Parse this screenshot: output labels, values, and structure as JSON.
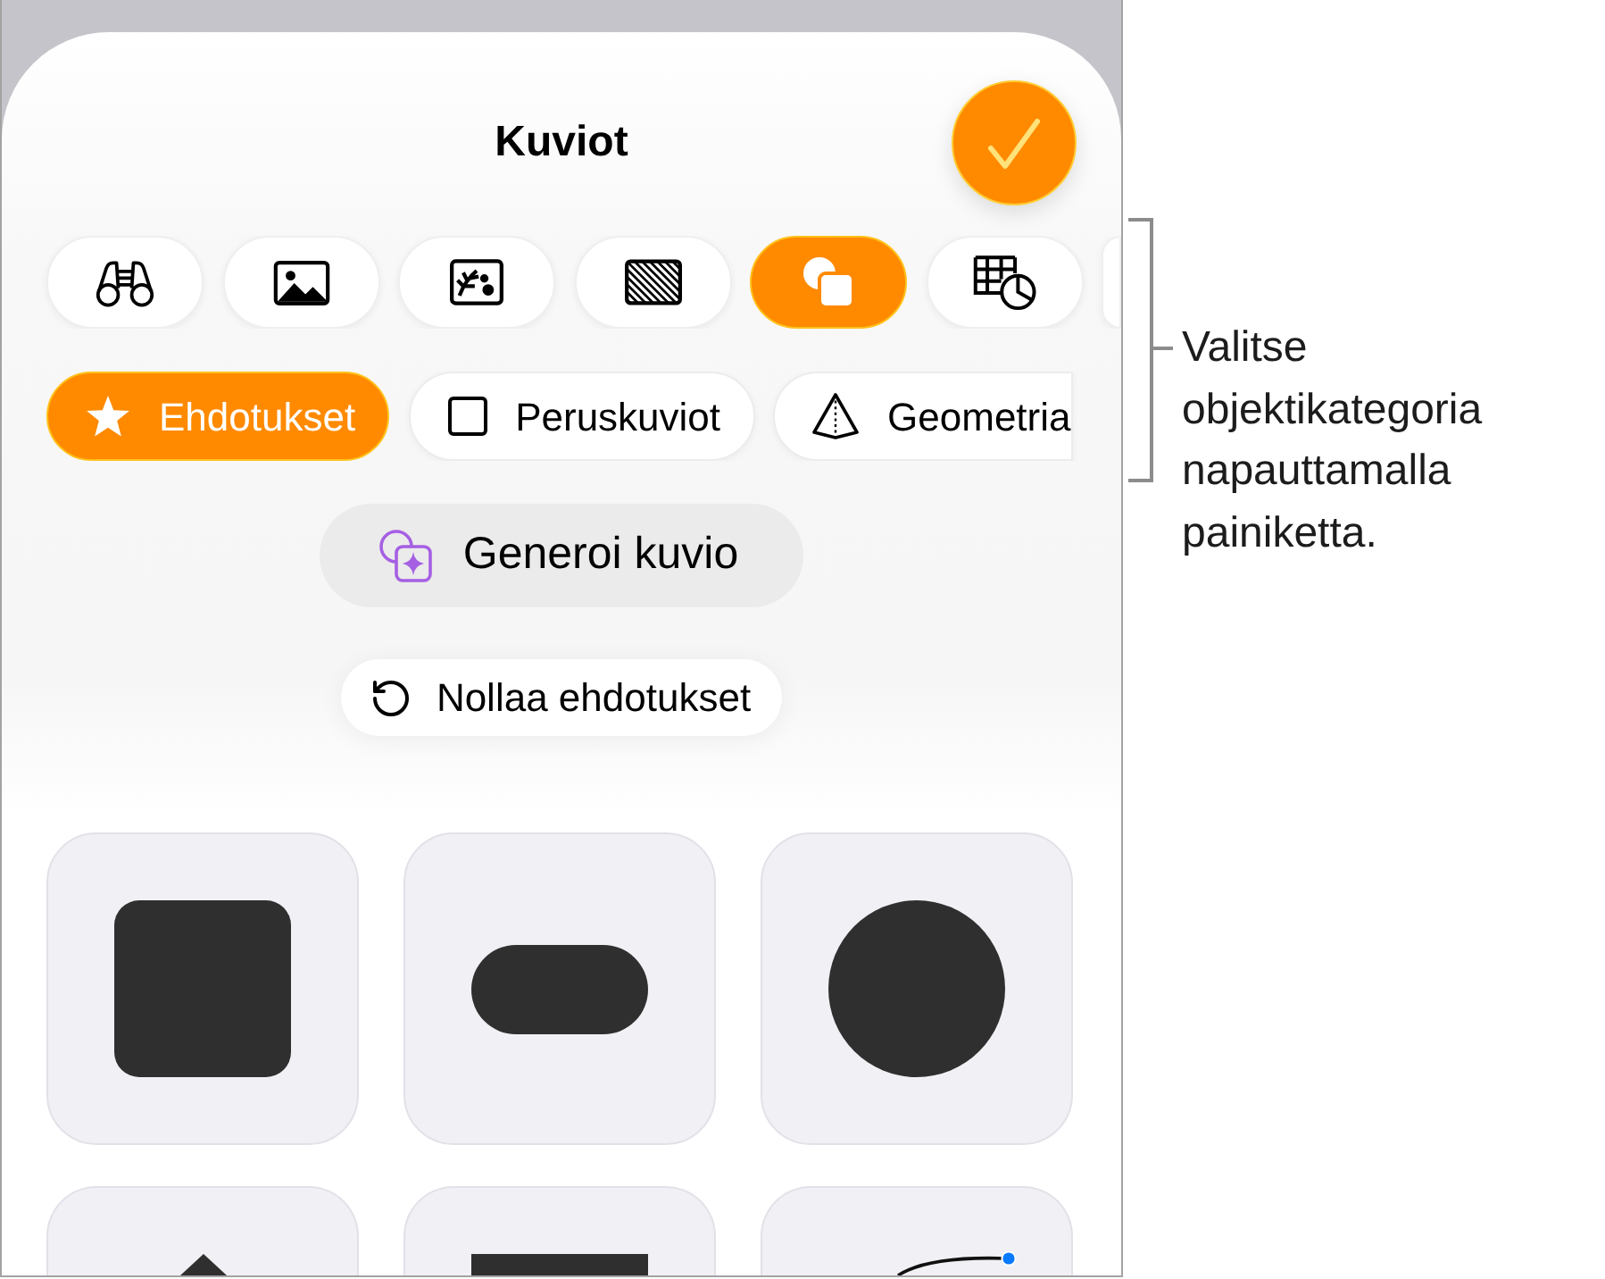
{
  "sheet": {
    "title": "Kuviot"
  },
  "object_categories": [
    {
      "kind": "binoculars",
      "selected": false
    },
    {
      "kind": "image",
      "selected": false
    },
    {
      "kind": "media",
      "selected": false
    },
    {
      "kind": "pattern",
      "selected": false
    },
    {
      "kind": "shapes",
      "selected": true
    },
    {
      "kind": "table-chart",
      "selected": false
    },
    {
      "kind": "cut-off",
      "selected": false
    }
  ],
  "shape_categories": [
    {
      "kind": "star",
      "label": "Ehdotukset",
      "selected": true
    },
    {
      "kind": "square",
      "label": "Peruskuviot",
      "selected": false
    },
    {
      "kind": "pyramid",
      "label": "Geometria",
      "selected": false
    }
  ],
  "generate_button": {
    "label": "Generoi kuvio"
  },
  "reset_button": {
    "label": "Nollaa ehdotukset"
  },
  "shape_tiles": [
    {
      "kind": "rounded-square"
    },
    {
      "kind": "pill"
    },
    {
      "kind": "circle"
    },
    {
      "kind": "triangle"
    },
    {
      "kind": "rectangle"
    },
    {
      "kind": "curve"
    }
  ],
  "callout": {
    "text": "Valitse objektikategoria napauttamalla painiketta."
  }
}
